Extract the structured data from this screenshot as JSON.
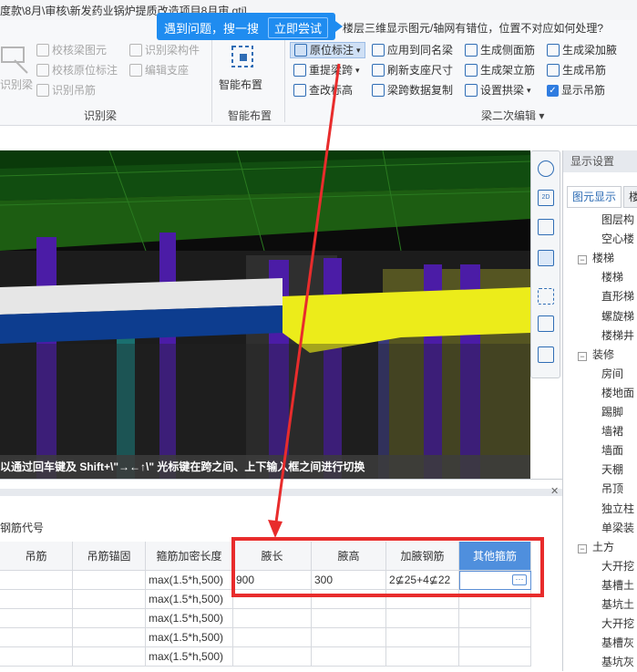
{
  "window": {
    "title": "度款\\8月\\审核\\新发药业锅炉提质改造项目8月审.gtj]"
  },
  "tooltip": {
    "text": "遇到问题，搜一搜",
    "action": "立即尝试",
    "question": "楼层三维显示图元/轴网有错位，位置不对应如何处理?"
  },
  "ribbon": {
    "identify_beam": {
      "label": "识别梁",
      "items": [
        "校核梁图元",
        "识别梁构件",
        "校核原位标注",
        "编辑支座",
        "识别吊筋"
      ],
      "big": "识别梁"
    },
    "smart_layout": {
      "label": "智能布置",
      "big": "智能布置"
    },
    "beam_edit": {
      "label": "梁二次编辑",
      "items": [
        "原位标注",
        "应用到同名梁",
        "生成侧面筋",
        "生成梁加腋",
        "重提梁跨",
        "刷新支座尺寸",
        "生成架立筋",
        "生成吊筋",
        "查改标高",
        "梁跨数据复制",
        "设置拱梁",
        "显示吊筋"
      ]
    }
  },
  "viewport": {
    "hint": "以通过回车键及 Shift+\\\"→←↑\\\" 光标键在跨之间、上下输入框之间进行切换",
    "tool_2d": "2D"
  },
  "display_panel": {
    "title": "显示设置",
    "tabs": [
      "图元显示",
      "楼"
    ],
    "tree": [
      {
        "label": "图层构",
        "indent": 1,
        "toggle": ""
      },
      {
        "label": "空心楼",
        "indent": 1,
        "toggle": ""
      },
      {
        "label": "楼梯",
        "indent": 0,
        "toggle": "−"
      },
      {
        "label": "楼梯",
        "indent": 1,
        "toggle": ""
      },
      {
        "label": "直形梯",
        "indent": 1,
        "toggle": ""
      },
      {
        "label": "螺旋梯",
        "indent": 1,
        "toggle": ""
      },
      {
        "label": "楼梯井",
        "indent": 1,
        "toggle": ""
      },
      {
        "label": "装修",
        "indent": 0,
        "toggle": "−"
      },
      {
        "label": "房间",
        "indent": 1,
        "toggle": ""
      },
      {
        "label": "楼地面",
        "indent": 1,
        "toggle": ""
      },
      {
        "label": "踢脚",
        "indent": 1,
        "toggle": ""
      },
      {
        "label": "墙裙",
        "indent": 1,
        "toggle": ""
      },
      {
        "label": "墙面",
        "indent": 1,
        "toggle": ""
      },
      {
        "label": "天棚",
        "indent": 1,
        "toggle": ""
      },
      {
        "label": "吊顶",
        "indent": 1,
        "toggle": ""
      },
      {
        "label": "独立柱",
        "indent": 1,
        "toggle": ""
      },
      {
        "label": "单梁装",
        "indent": 1,
        "toggle": ""
      },
      {
        "label": "土方",
        "indent": 0,
        "toggle": "−"
      },
      {
        "label": "大开挖",
        "indent": 1,
        "toggle": ""
      },
      {
        "label": "基槽土",
        "indent": 1,
        "toggle": ""
      },
      {
        "label": "基坑土",
        "indent": 1,
        "toggle": ""
      },
      {
        "label": "大开挖",
        "indent": 1,
        "toggle": ""
      },
      {
        "label": "基槽灰",
        "indent": 1,
        "toggle": ""
      },
      {
        "label": "基坑灰",
        "indent": 1,
        "toggle": ""
      }
    ]
  },
  "table": {
    "caption": "钢筋代号",
    "headers": [
      "吊筋",
      "吊筋锚固",
      "箍筋加密长度",
      "腋长",
      "腋高",
      "加腋钢筋",
      "其他箍筋"
    ],
    "rows": [
      [
        "",
        "",
        "max(1.5*h,500)",
        "900",
        "300",
        "2⊈25+4⊈22",
        ""
      ],
      [
        "",
        "",
        "max(1.5*h,500)",
        "",
        "",
        "",
        ""
      ],
      [
        "",
        "",
        "max(1.5*h,500)",
        "",
        "",
        "",
        ""
      ],
      [
        "",
        "",
        "max(1.5*h,500)",
        "",
        "",
        "",
        ""
      ],
      [
        "",
        "",
        "max(1.5*h,500)",
        "",
        "",
        "",
        ""
      ]
    ],
    "ellipsis": "···"
  },
  "colors": {
    "highlight_red": "#e82c2c",
    "tooltip_blue": "#1f8cf0",
    "header_selected": "#4f8fdd",
    "beam_yellow": "#ecec1a",
    "column_purple": "#4b1ca6"
  }
}
